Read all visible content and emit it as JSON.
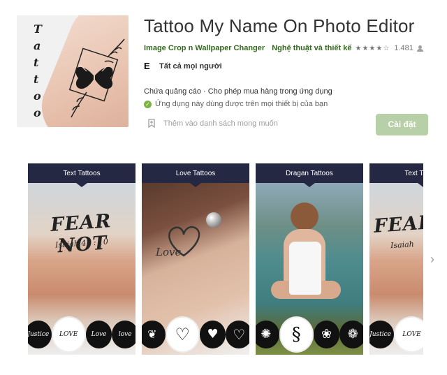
{
  "app": {
    "title": "Tattoo My Name On Photo Editor",
    "developer": "Image Crop n Wallpaper Changer",
    "category": "Nghệ thuật và thiết kế",
    "stars": "★★★★☆",
    "rating_count": "1.481",
    "content_rating_badge": "E",
    "content_rating": "Tất cả mọi người",
    "ads_notice": "Chứa quảng cáo · Cho phép mua hàng trong ứng dụng",
    "compatibility": "Ứng dụng này dùng được trên mọi thiết bị của bạn",
    "wishlist_label": "Thêm vào danh sách mong muốn",
    "install_label": "Cài đặt"
  },
  "icon": {
    "letters": [
      "T",
      "a",
      "t",
      "t",
      "o",
      "o"
    ]
  },
  "screenshots": [
    {
      "heading": "Text  Tattoos",
      "main_text": "FEAR NOT",
      "sub_text": "Isaiah  41 : 10",
      "circles": [
        "Justice",
        "LOVE",
        "Love",
        "love you"
      ]
    },
    {
      "heading": "Love  Tattoos",
      "tattoo_text": "Love",
      "circles": [
        "❦",
        "♡",
        "♥",
        "♡"
      ]
    },
    {
      "heading": "Dragan Tattoos",
      "circles": [
        "✺",
        "§",
        "❀",
        "❁"
      ]
    },
    {
      "heading": "Text  Tattoos",
      "main_text": "FEAR",
      "sub_text": "Isaiah",
      "circles": [
        "Justice",
        "LOVE"
      ]
    }
  ],
  "icons": {
    "person": "person-icon",
    "check": "check-circle-icon",
    "bookmark": "bookmark-add-icon",
    "next": "chevron-right-icon"
  },
  "colors": {
    "accent_green": "#33691e",
    "install_button": "#b7d0a8",
    "banner_navy": "#242843"
  }
}
